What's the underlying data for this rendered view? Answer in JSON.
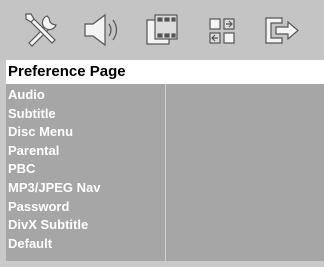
{
  "toolbar": {
    "icons": [
      {
        "name": "general-setup-icon"
      },
      {
        "name": "audio-setup-icon"
      },
      {
        "name": "video-setup-icon"
      },
      {
        "name": "preference-setup-icon"
      },
      {
        "name": "exit-icon"
      }
    ]
  },
  "page": {
    "title": "Preference Page"
  },
  "menu": {
    "items": [
      {
        "label": "Audio"
      },
      {
        "label": "Subtitle"
      },
      {
        "label": "Disc Menu"
      },
      {
        "label": "Parental"
      },
      {
        "label": "PBC"
      },
      {
        "label": "MP3/JPEG Nav"
      },
      {
        "label": "Password"
      },
      {
        "label": "DivX Subtitle"
      },
      {
        "label": "Default"
      }
    ]
  },
  "colors": {
    "toolbar_bg": "#c4c4c4",
    "menu_bg": "#a6a6a6",
    "title_bg": "#ffffff",
    "menu_text": "#ffffff"
  }
}
